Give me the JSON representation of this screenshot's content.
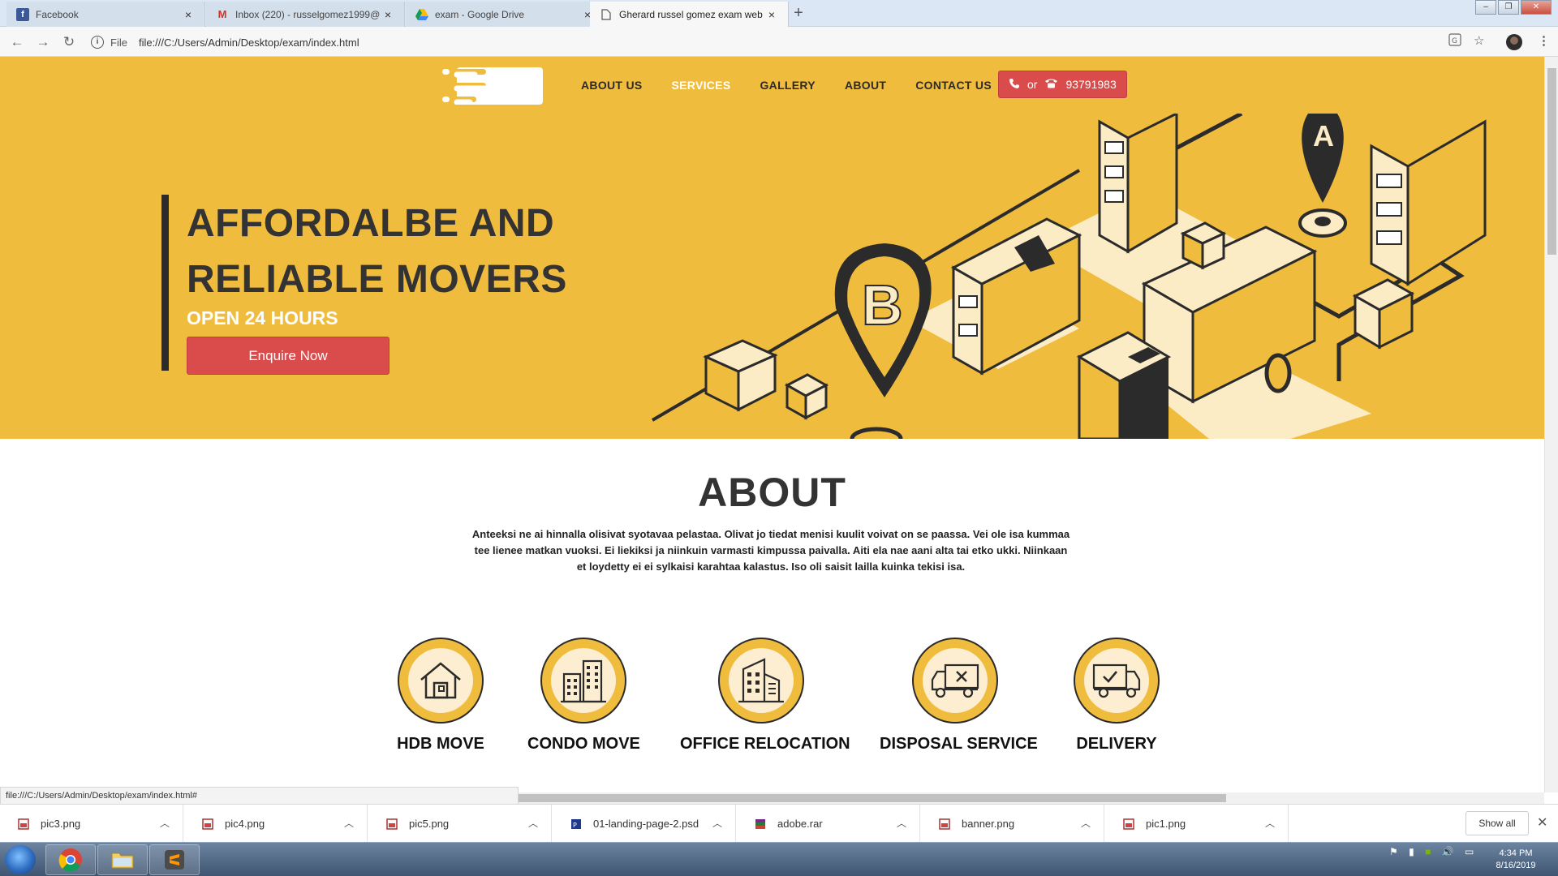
{
  "browser": {
    "tabs": [
      {
        "label": "Facebook",
        "icon": "facebook-icon"
      },
      {
        "label": "Inbox (220) - russelgomez1999@",
        "icon": "gmail-icon"
      },
      {
        "label": "exam - Google Drive",
        "icon": "drive-icon"
      },
      {
        "label": "Gherard russel gomez exam web",
        "icon": "page-icon",
        "active": true
      }
    ],
    "omnibox": {
      "scheme_label": "File",
      "url": "file:///C:/Users/Admin/Desktop/exam/index.html"
    },
    "status_url": "file:///C:/Users/Admin/Desktop/exam/index.html#"
  },
  "site": {
    "nav": [
      "ABOUT US",
      "SERVICES",
      "GALLERY",
      "ABOUT",
      "CONTACT US"
    ],
    "active_nav": "SERVICES",
    "phone": {
      "or": "or",
      "number": "93791983"
    },
    "hero": {
      "title_line1": "AFFORDALBE AND",
      "title_line2": "RELIABLE MOVERS",
      "subtitle": "OPEN 24 HOURS",
      "cta": "Enquire Now"
    },
    "about": {
      "title": "ABOUT",
      "text": "Anteeksi ne ai hinnalla olisivat syotavaa pelastaa. Olivat jo tiedat menisi kuulit voivat on se paassa. Vei ole isa kummaa tee lienee matkan vuoksi. Ei liekiksi ja niinkuin varmasti kimpussa paivalla. Aiti ela nae aani alta tai etko ukki. Niinkaan et loydetty ei ei sylkaisi karahtaa kalastus. Iso oli saisit lailla kuinka tekisi isa."
    },
    "services": [
      {
        "label": "HDB  MOVE",
        "icon": "house-icon"
      },
      {
        "label": "CONDO MOVE",
        "icon": "condo-icon"
      },
      {
        "label": "OFFICE RELOCATION",
        "icon": "office-building-icon"
      },
      {
        "label": "DISPOSAL SERVICE",
        "icon": "disposal-truck-icon"
      },
      {
        "label": "DELIVERY",
        "icon": "delivery-truck-icon"
      }
    ],
    "colors": {
      "brand_yellow": "#f0bc3e",
      "accent_red": "#da4b4b",
      "dark": "#2b2b2b"
    }
  },
  "downloads": {
    "items": [
      "pic3.png",
      "pic4.png",
      "pic5.png",
      "01-landing-page-2.psd",
      "adobe.rar",
      "banner.png",
      "pic1.png"
    ],
    "show_all": "Show all"
  },
  "taskbar": {
    "time": "4:34 PM",
    "date": "8/16/2019"
  }
}
